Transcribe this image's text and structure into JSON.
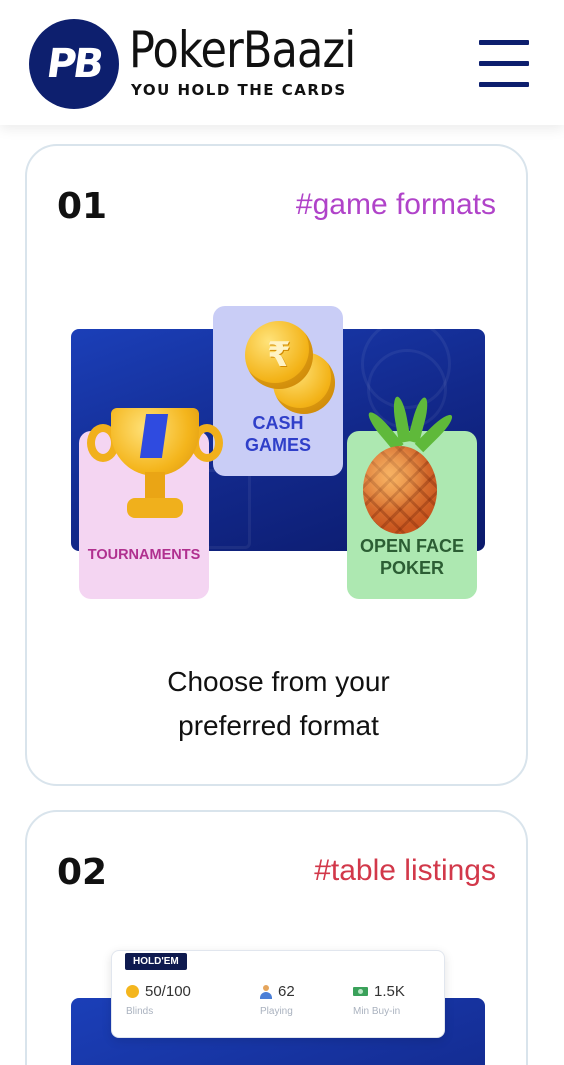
{
  "header": {
    "logo_mark": "PB",
    "brand_name": "PokerBaazi",
    "tagline": "YOU HOLD THE CARDS",
    "menu_icon": "hamburger-menu-icon"
  },
  "colors": {
    "brand_navy": "#0d1f6e",
    "tag_purple": "#b043c9",
    "tag_red": "#d2384a"
  },
  "cards": [
    {
      "number": "01",
      "tag": "#game formats",
      "tiles": {
        "cash": "CASH GAMES",
        "tournaments": "TOURNAMENTS",
        "ofp": "OPEN FACE POKER"
      },
      "coin_symbol": "₹",
      "caption_line1": "Choose from your",
      "caption_line2": "preferred format"
    },
    {
      "number": "02",
      "tag": "#table listings",
      "table": {
        "badge": "HOLD'EM",
        "blinds_value": "50/100",
        "blinds_label": "Blinds",
        "playing_value": "62",
        "playing_label": "Playing",
        "minbuyin_value": "1.5K",
        "minbuyin_label": "Min Buy-in"
      }
    }
  ]
}
